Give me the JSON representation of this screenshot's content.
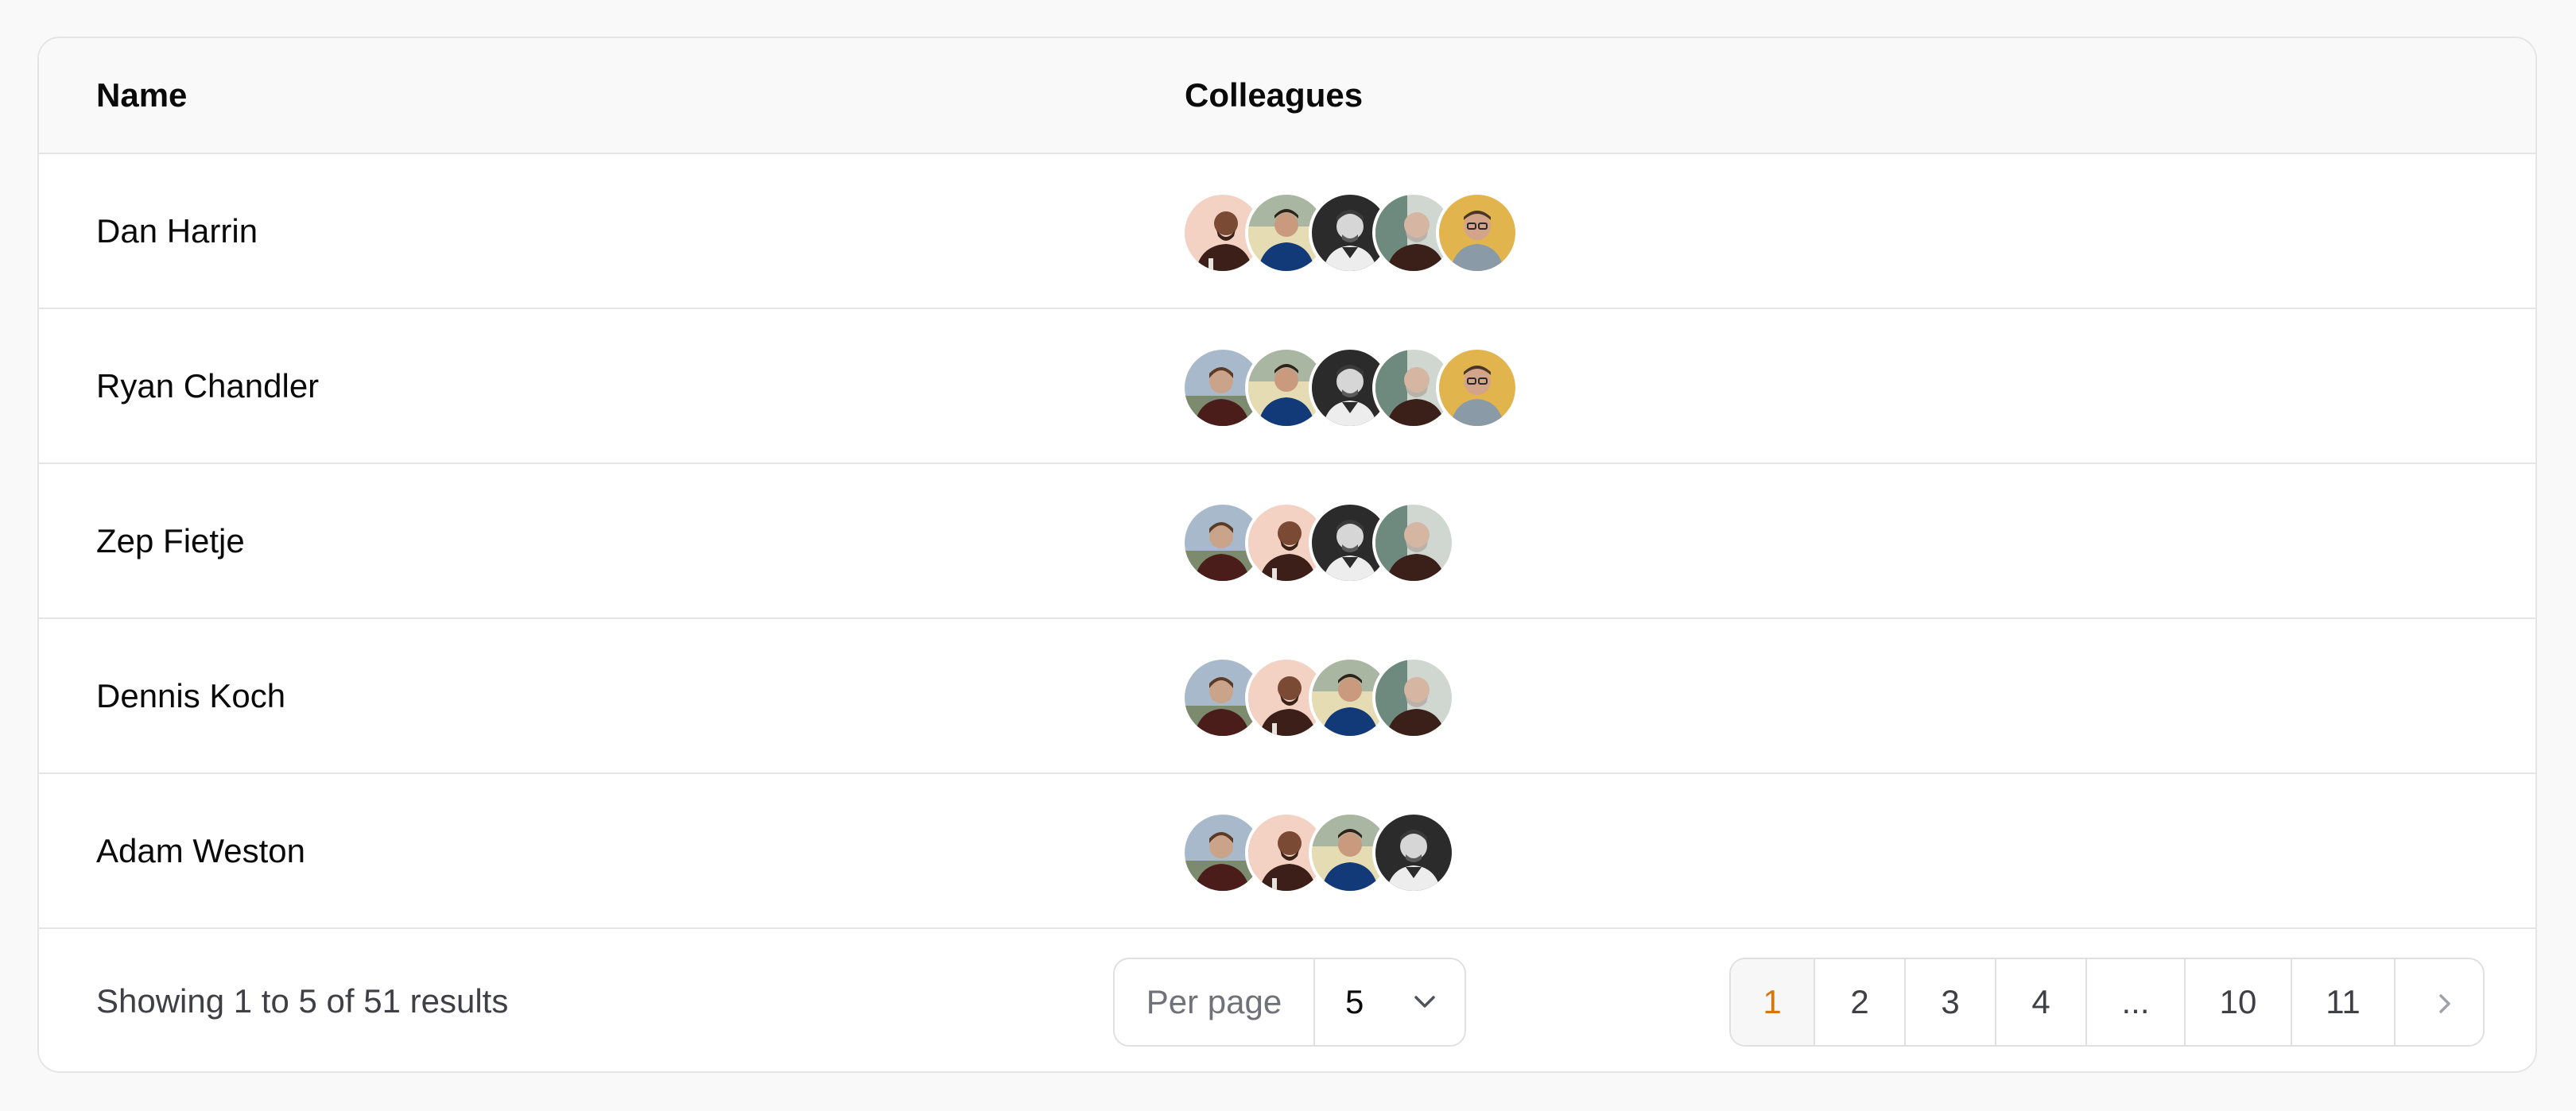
{
  "table": {
    "columns": [
      "Name",
      "Colleagues"
    ],
    "rows": [
      {
        "name": "Dan Harrin",
        "colleague_avatars": [
          "avatar-peach",
          "avatar-blue-sweater",
          "avatar-bw",
          "avatar-grey-beard",
          "avatar-yellow"
        ]
      },
      {
        "name": "Ryan Chandler",
        "colleague_avatars": [
          "avatar-sky",
          "avatar-blue-sweater",
          "avatar-bw",
          "avatar-grey-beard",
          "avatar-yellow"
        ]
      },
      {
        "name": "Zep Fietje",
        "colleague_avatars": [
          "avatar-sky",
          "avatar-peach",
          "avatar-bw",
          "avatar-grey-beard"
        ]
      },
      {
        "name": "Dennis Koch",
        "colleague_avatars": [
          "avatar-sky",
          "avatar-peach",
          "avatar-blue-sweater",
          "avatar-grey-beard"
        ]
      },
      {
        "name": "Adam Weston",
        "colleague_avatars": [
          "avatar-sky",
          "avatar-peach",
          "avatar-blue-sweater",
          "avatar-bw"
        ]
      }
    ]
  },
  "footer": {
    "summary": "Showing 1 to 5 of 51 results",
    "per_page_label": "Per page",
    "per_page_value": "5",
    "pages": [
      "1",
      "2",
      "3",
      "4",
      "...",
      "10",
      "11"
    ],
    "active_page": "1"
  },
  "colors": {
    "accent": "#d97706",
    "border": "#e5e5e5",
    "header_bg": "#f9f9f9"
  }
}
